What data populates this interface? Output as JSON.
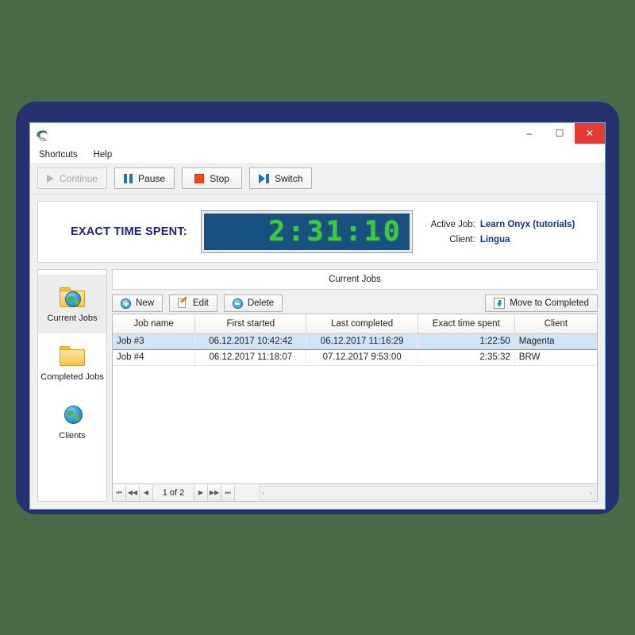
{
  "window": {
    "icon": "app-icon",
    "buttons": {
      "minimize": "–",
      "maximize": "☐",
      "close": "✕"
    }
  },
  "menu": {
    "items": [
      {
        "label": "Shortcuts"
      },
      {
        "label": "Help"
      }
    ]
  },
  "toolbar": {
    "buttons": [
      {
        "label": "Continue",
        "icon": "play-icon",
        "enabled": false
      },
      {
        "label": "Pause",
        "icon": "pause-icon",
        "enabled": true
      },
      {
        "label": "Stop",
        "icon": "stop-icon",
        "enabled": true
      },
      {
        "label": "Switch",
        "icon": "switch-icon",
        "enabled": true
      }
    ]
  },
  "timer": {
    "label": "EXACT TIME SPENT:",
    "display": "2:31:10",
    "active_job_label": "Active Job:",
    "active_job_value": "Learn Onyx (tutorials)",
    "client_label": "Client:",
    "client_value": "Lingua",
    "led_color": "#3ec93e",
    "led_background": "#18507f"
  },
  "sidebar": {
    "items": [
      {
        "label": "Current Jobs",
        "icon": "folder-globe-icon",
        "active": true
      },
      {
        "label": "Completed Jobs",
        "icon": "folder-icon",
        "active": false
      },
      {
        "label": "Clients",
        "icon": "globe-icon",
        "active": false
      }
    ]
  },
  "main": {
    "panel_title": "Current Jobs",
    "actions": {
      "new": "New",
      "edit": "Edit",
      "delete": "Delete",
      "move_to_completed": "Move to Completed"
    },
    "grid": {
      "columns": [
        "Job name",
        "First started",
        "Last completed",
        "Exact time spent",
        "Client"
      ],
      "rows": [
        {
          "job_name": "Job #3",
          "first_started": "06.12.2017 10:42:42",
          "last_completed": "06.12.2017 11:16:29",
          "exact_time_spent": "1:22:50",
          "client": "Magenta",
          "selected": true
        },
        {
          "job_name": "Job #4",
          "first_started": "06.12.2017 11:18:07",
          "last_completed": "07.12.2017 9:53:00",
          "exact_time_spent": "2:35:32",
          "client": "BRW",
          "selected": false
        }
      ]
    },
    "navigator": {
      "first": "⏮",
      "prev_page": "◀◀",
      "prev": "◀",
      "page_text": "1 of 2",
      "next": "▶",
      "next_page": "▶▶",
      "last": "⏭",
      "scroll_left": "‹",
      "scroll_right": "›"
    }
  },
  "theme": {
    "page_background": "#466b46",
    "panel_navy": "#25306e",
    "selection_blue": "#cfe4f5",
    "accent_blue": "#14328c",
    "close_red": "#e53935"
  }
}
